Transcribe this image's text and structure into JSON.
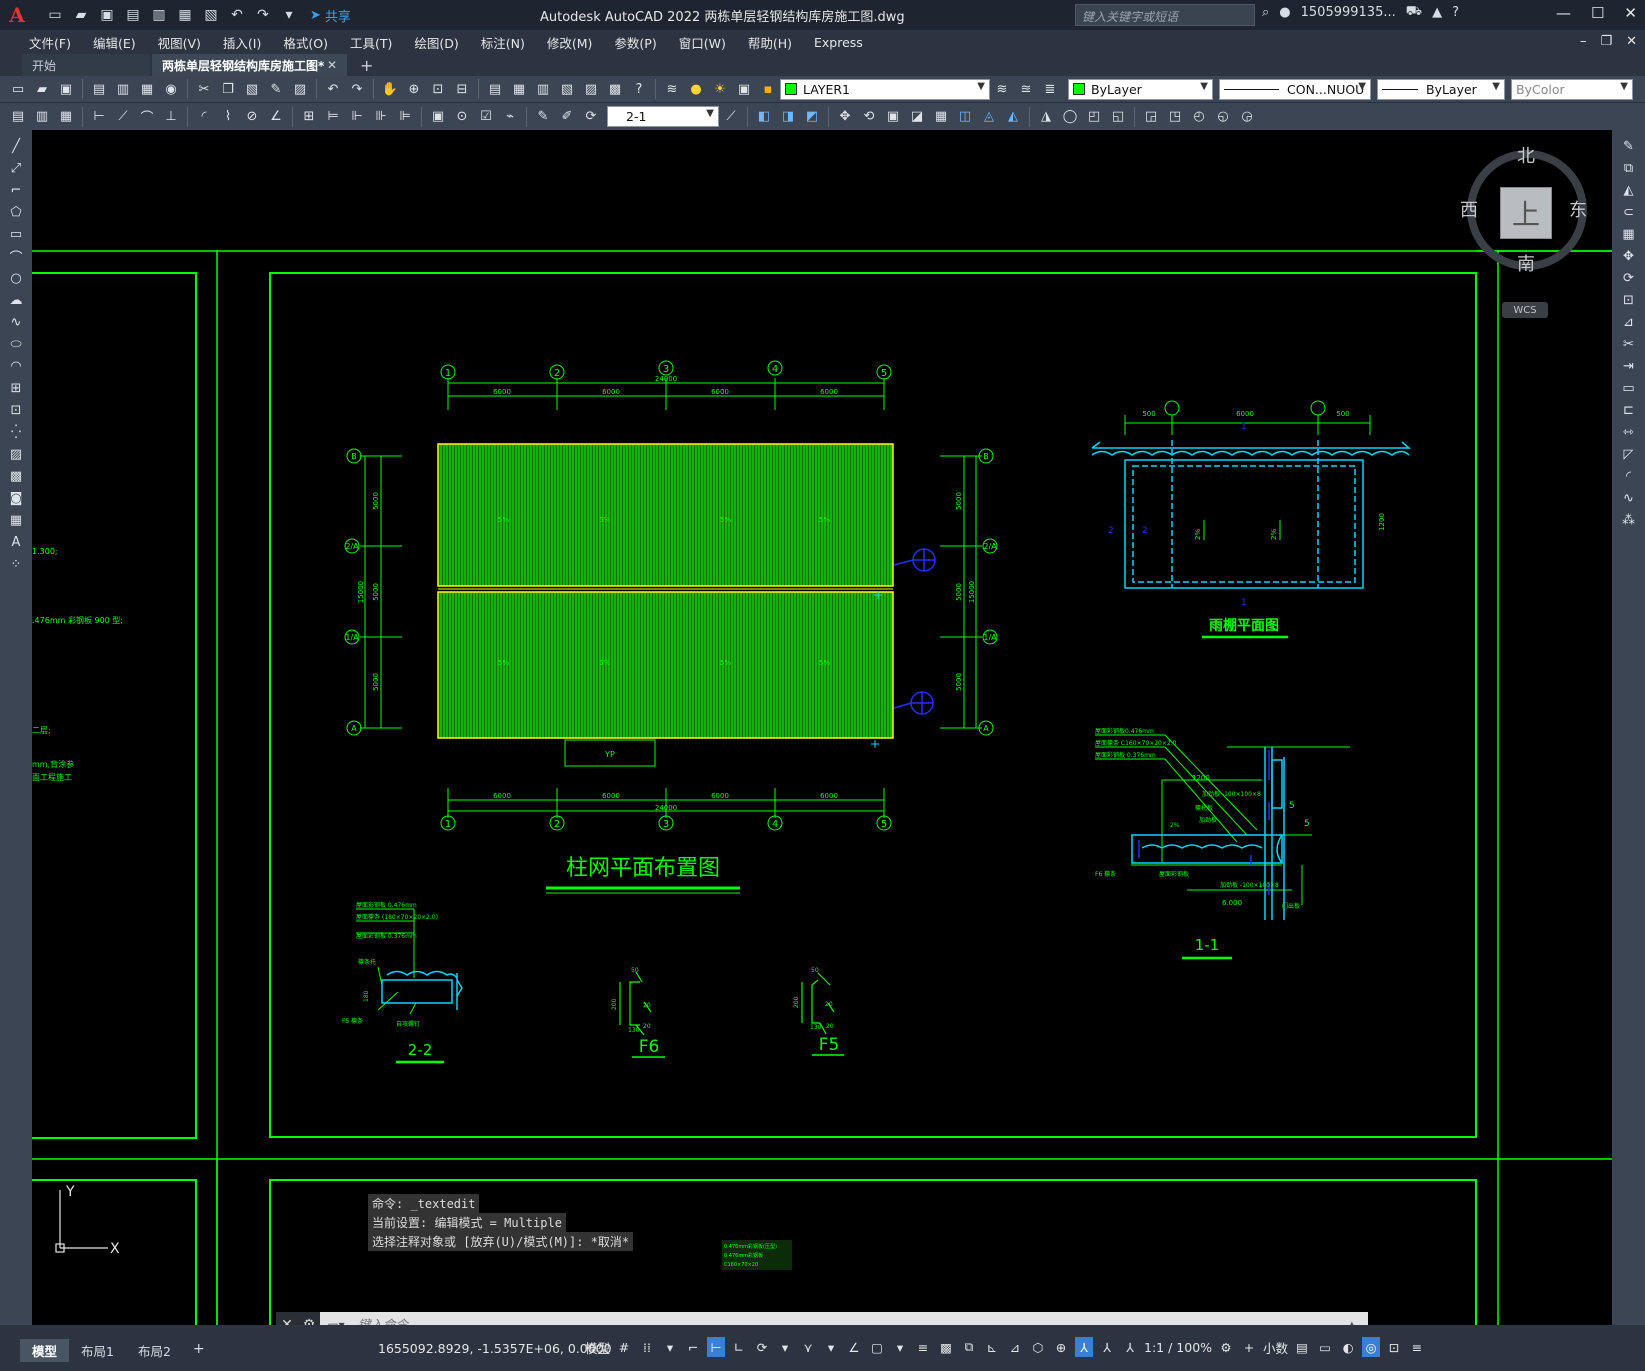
{
  "title_bar": {
    "app_logo": "A",
    "share_label": "共享",
    "title": "Autodesk AutoCAD 2022    两栋单层轻钢结构库房施工图.dwg",
    "search_placeholder": "键入关键字或短语",
    "user": "1505999135...",
    "help": "?"
  },
  "menu": {
    "items": [
      "文件(F)",
      "编辑(E)",
      "视图(V)",
      "插入(I)",
      "格式(O)",
      "工具(T)",
      "绘图(D)",
      "标注(N)",
      "修改(M)",
      "参数(P)",
      "窗口(W)",
      "帮助(H)",
      "Express"
    ]
  },
  "doc_tabs": {
    "start": "开始",
    "active": "两栋单层轻钢结构库房施工图*",
    "close": "✕",
    "add": "+"
  },
  "toolbar": {
    "layer_name": "LAYER1",
    "color": "ByLayer",
    "linetype": "CON...NUOU",
    "lineweight": "ByLayer",
    "plotstyle": "ByColor",
    "dimstyle": "2-1"
  },
  "viewcube": {
    "north": "北",
    "south": "南",
    "east": "东",
    "west": "西",
    "face": "上",
    "wcs": "WCS"
  },
  "drawing": {
    "main_title": "柱网平面布置图",
    "canopy_title": "雨棚平面图",
    "section_1_1": "1-1",
    "section_2_2": "2-2",
    "detail_f6": "F6",
    "detail_f5": "F5",
    "left_notes": [
      "1.300;",
      ".476mm 彩钢板 900 型;",
      "二层;",
      "mm,背涂参",
      "面工程施工"
    ],
    "axis_top": [
      "1",
      "2",
      "3",
      "4",
      "5"
    ],
    "axis_side": [
      "B",
      "2/A",
      "1/A",
      "A"
    ],
    "dim_spans": [
      "6000",
      "6000",
      "6000",
      "6000"
    ],
    "dim_total": "24000",
    "dim_side_spans": [
      "5000",
      "5000",
      "5000"
    ],
    "dim_side_total": "15000",
    "yp_label": "YP",
    "canopy_dims": [
      "500",
      "6000",
      "500",
      "1200"
    ],
    "section_notes_1_1": [
      "屋面彩钢板0.476mm",
      "屋面檩条 C160×70×20×2.0",
      "屋面彩钢板 0.376mm",
      "1200",
      "加劲板 -100×100×8",
      "檩托板",
      "加劲板",
      "2%",
      "F6 檩条",
      "屋面彩钢板",
      "加劲板 -100×100×8",
      "6.000",
      "门出板"
    ],
    "section_notes_2_2": [
      "屋面彩钢板 0.476mm",
      "屋面檩条 (180×70×20×2.0)",
      "屋面彩钢板 0.376mm",
      "檩条托",
      "180",
      "F5 檩条",
      "自攻螺钉"
    ],
    "detail_dims": [
      "50",
      "20",
      "200",
      "130",
      "20"
    ],
    "bottom_notes": [
      "0.476mm彩钢板(压型)",
      "0.476mm彩钢板",
      "C160×70×20"
    ],
    "ucs_x": "X",
    "ucs_y": "Y"
  },
  "command": {
    "history": [
      "命令: _textedit",
      "当前设置: 编辑模式 = Multiple",
      "选择注释对象或 [放弃(U)/模式(M)]: *取消*"
    ],
    "input_placeholder": "键入命令"
  },
  "status": {
    "layout_tabs": [
      "模型",
      "布局1",
      "布局2"
    ],
    "add": "+",
    "coords": "1655092.8929, -1.5357E+06, 0.0000",
    "space": "模型",
    "annoscale": "1:1 / 100%",
    "units": "小数"
  },
  "colors": {
    "drawing_green": "#00ff00",
    "drawing_cyan": "#00d8ff",
    "drawing_blue": "#2030ff",
    "drawing_yellow": "#ffff00",
    "ui_dark": "#2b3440",
    "ui_toolbar": "#3b4553",
    "accent_blue": "#3a7fd1"
  }
}
